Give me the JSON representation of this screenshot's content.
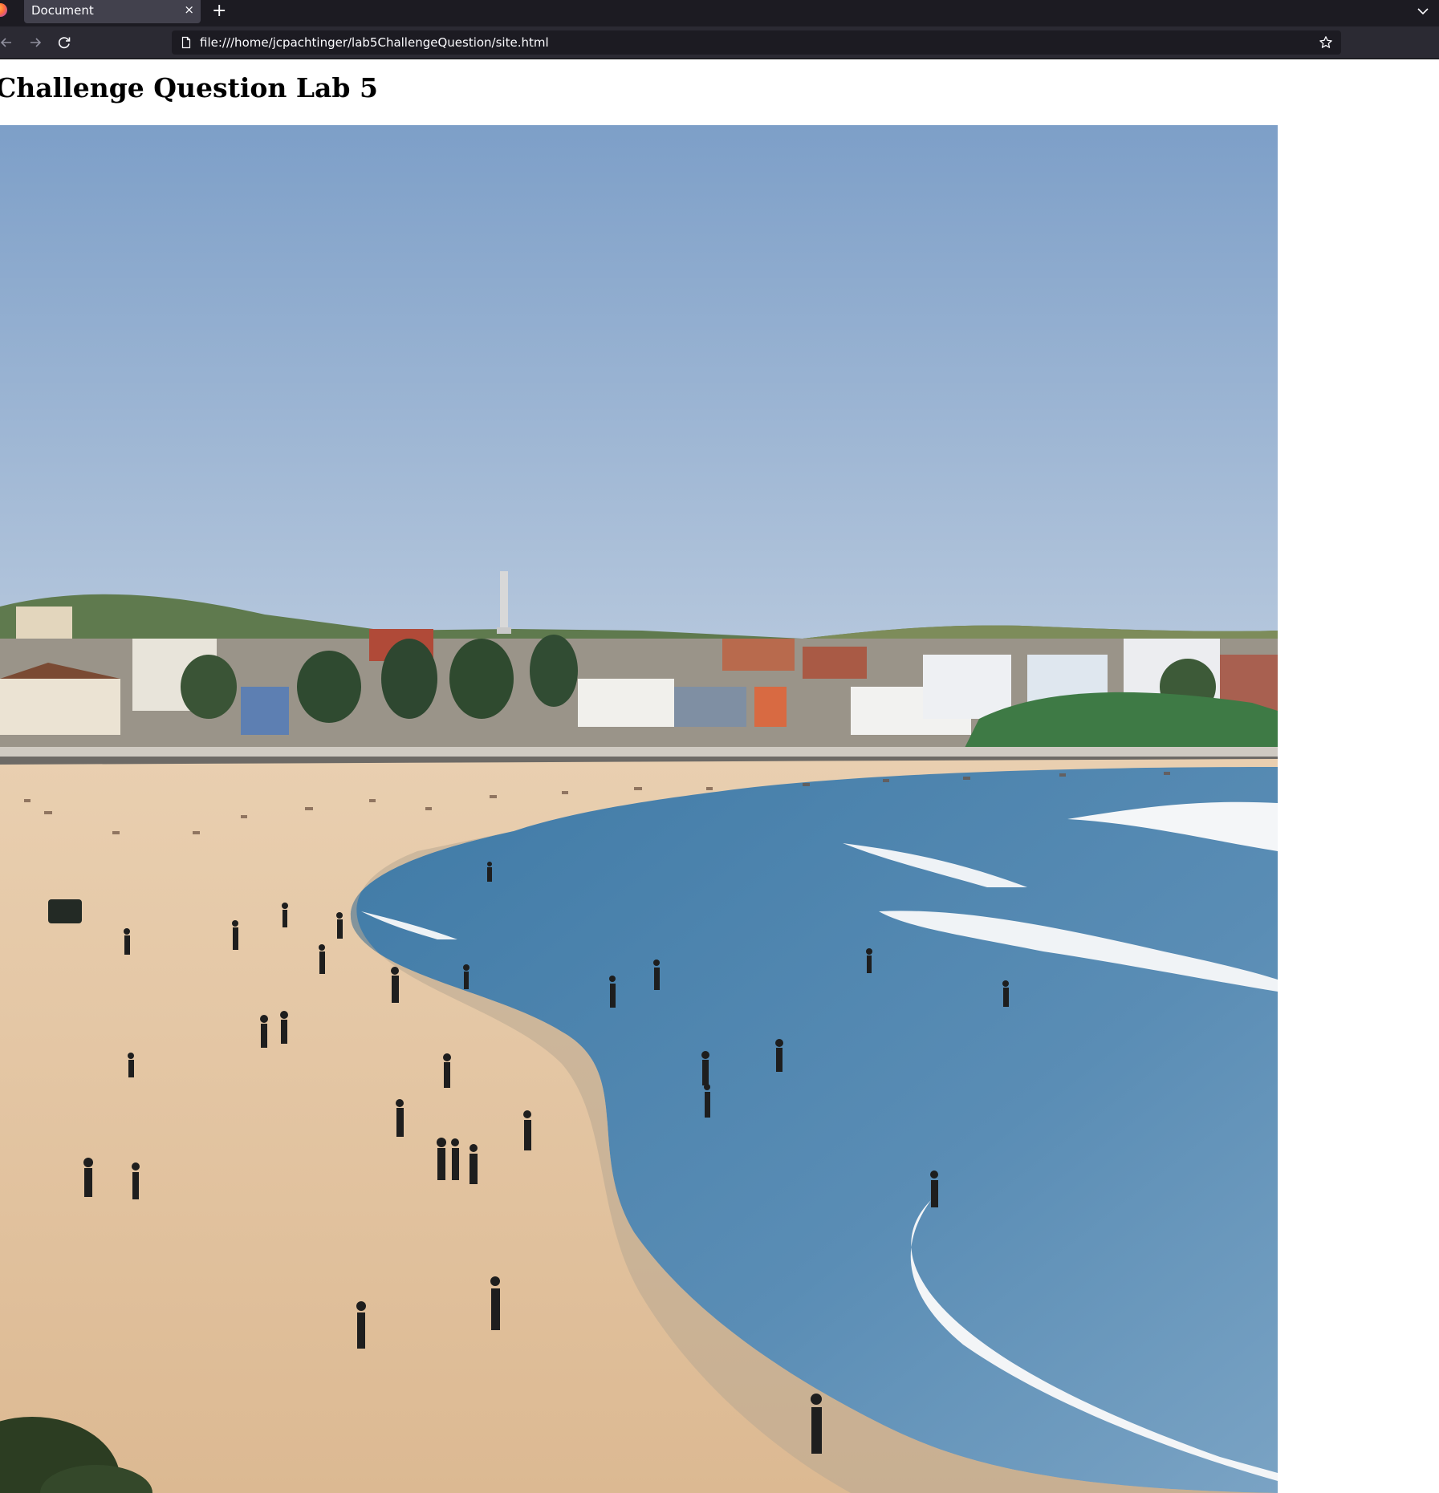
{
  "browser": {
    "tab_title": "Document",
    "tab_close": "×",
    "new_tab": "+",
    "url": "file:///home/jcpachtinger/lab5ChallengeQuestion/site.html"
  },
  "page": {
    "heading": "Challenge Question Lab 5"
  },
  "colors": {
    "chrome_dark": "#1c1b22",
    "chrome_tab": "#42414d",
    "sky": "#8fb0d6",
    "sand": "#e6c9a5",
    "sea": "#4d80aa"
  },
  "icons": {
    "back": "back-arrow-icon",
    "forward": "forward-arrow-icon",
    "reload": "reload-icon",
    "page": "page-icon",
    "bookmark": "star-icon",
    "tab_list": "chevron-down-icon"
  }
}
